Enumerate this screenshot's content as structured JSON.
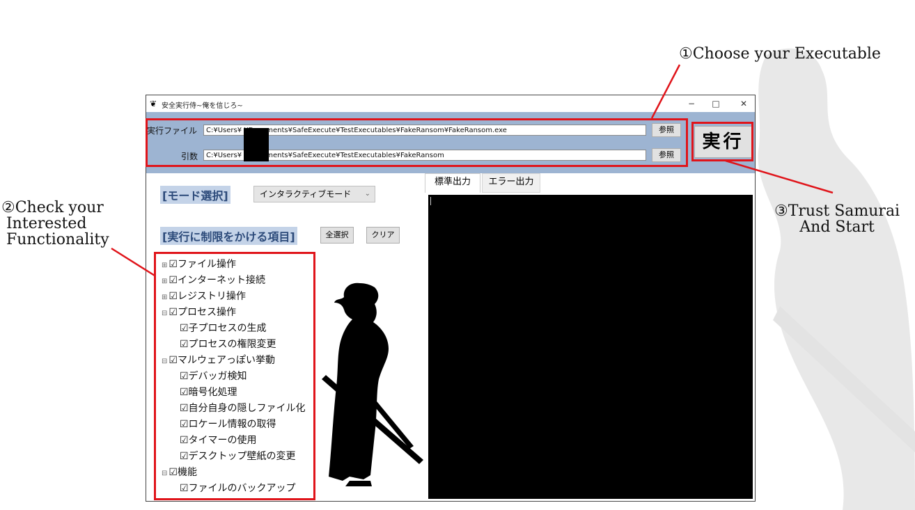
{
  "annotations": {
    "choose": "①Choose your Executable",
    "check_line1": "②Check your",
    "check_line2": " Interested",
    "check_line3": " Functionality",
    "trust_line1": "③Trust Samurai",
    "trust_line2": "And Start"
  },
  "window": {
    "title": "安全実行侍~俺を信じろ~",
    "minimize": "−",
    "maximize": "□",
    "close": "✕"
  },
  "topbar": {
    "exe_label": "実行ファイル",
    "exe_path": "C:¥Users¥        ¥Documents¥SafeExecute¥TestExecutables¥FakeRansom¥FakeRansom.exe",
    "arg_label": "引数",
    "arg_path": "C:¥Users¥        ¥Documents¥SafeExecute¥TestExecutables¥FakeRansom",
    "browse_label": "参照",
    "run_label": "実行"
  },
  "left": {
    "mode_heading": "[モード選択]",
    "mode_value": "インタラクティブモード",
    "restrict_heading": "[実行に制限をかける項目]",
    "select_all": "全選択",
    "clear": "クリア",
    "tree": [
      {
        "expander": "⊞",
        "label": "☑ファイル操作"
      },
      {
        "expander": "⊞",
        "label": "☑インターネット接続"
      },
      {
        "expander": "⊞",
        "label": "☑レジストリ操作"
      },
      {
        "expander": "⊟",
        "label": "☑プロセス操作"
      },
      {
        "expander": "",
        "label": "☑子プロセスの生成"
      },
      {
        "expander": "",
        "label": "☑プロセスの権限変更"
      },
      {
        "expander": "⊟",
        "label": "☑マルウェアっぽい挙動"
      },
      {
        "expander": "",
        "label": "☑デバッガ検知"
      },
      {
        "expander": "",
        "label": "☑暗号化処理"
      },
      {
        "expander": "",
        "label": "☑自分自身の隠しファイル化"
      },
      {
        "expander": "",
        "label": "☑ロケール情報の取得"
      },
      {
        "expander": "",
        "label": "☑タイマーの使用"
      },
      {
        "expander": "",
        "label": "☑デスクトップ壁紙の変更"
      },
      {
        "expander": "⊟",
        "label": "☑機能"
      },
      {
        "expander": "",
        "label": "☑ファイルのバックアップ"
      }
    ]
  },
  "right": {
    "tab_stdout": "標準出力",
    "tab_stderr": "エラー出力"
  },
  "colors": {
    "annotation_red": "#e0141a",
    "topbar_blue": "#9db4d2",
    "heading_blue": "#2c4a7a"
  }
}
